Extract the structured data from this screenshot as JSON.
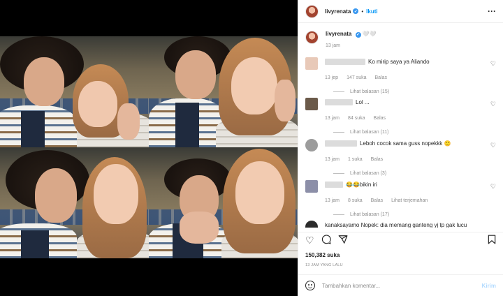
{
  "header": {
    "username": "livyrenata",
    "separator": "•",
    "follow_label": "Ikuti",
    "more_icon": "more-horizontal-icon"
  },
  "caption": {
    "username": "livyrenata",
    "text": "🤍🤍",
    "time": "13 jam"
  },
  "comments": [
    {
      "text": "Ko mirip saya ya Aliando",
      "time": "13 jep",
      "likes": "147 suka",
      "reply": "Balas",
      "replies": "Lihat balasan (15)",
      "avatar_color": "#e8c9b8",
      "name_width": 58
    },
    {
      "text": "Lol ...",
      "time": "13 jam",
      "likes": "84 suka",
      "reply": "Balas",
      "replies": "Lihat balasan (11)",
      "avatar_color": "#6b5a4a",
      "name_width": 40
    },
    {
      "text": "Leboh cocok sama guss nopekkk 🙂",
      "time": "13 jam",
      "likes": "1 suka",
      "reply": "Balas",
      "replies": "Lihat balasan (3)",
      "avatar_color": "#9c9c9c",
      "name_width": 46
    },
    {
      "text": "😂😂bikin iri",
      "time": "13 jam",
      "likes": "8 suka",
      "reply": "Balas",
      "translate": "Lihat terjemahan",
      "replies": "Lihat balasan (17)",
      "avatar_color": "#8c8fa8",
      "name_width": 26
    },
    {
      "text": "kanaksayamo Nopek: dia memang ganteng yj tp gak lucu",
      "avatar_color": "#2b2b2b"
    }
  ],
  "actions": {
    "like_icon": "heart-icon",
    "comment_icon": "comment-icon",
    "share_icon": "share-icon",
    "save_icon": "bookmark-icon"
  },
  "likes": "150,382 suka",
  "post_time": "13 JAM YANG LALU",
  "add_comment": {
    "placeholder": "Tambahkan komentar...",
    "send_label": "Kirim"
  },
  "colors": {
    "accent": "#0095f6",
    "verified": "#3897f0",
    "send_disabled": "#b3dbff",
    "meta_text": "#8e8e8e"
  }
}
